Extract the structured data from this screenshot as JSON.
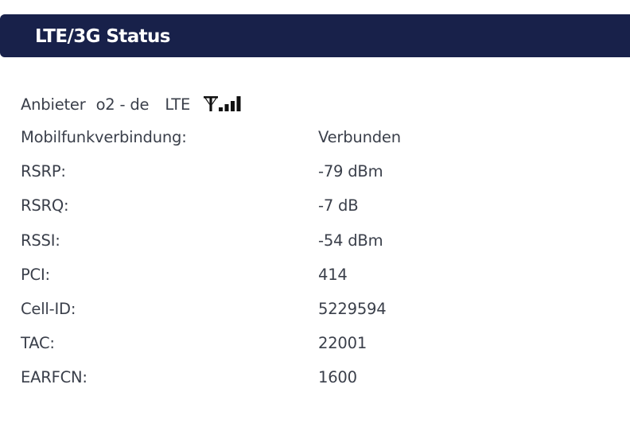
{
  "header": {
    "title": "LTE/3G Status"
  },
  "provider": {
    "label": "Anbieter",
    "name": "o2 - de",
    "technology": "LTE",
    "signal_icon": "signal-strength-icon",
    "signal_bars_lit": 4,
    "signal_bars_total": 4
  },
  "status_rows": [
    {
      "label": "Mobilfunkverbindung:",
      "value": "Verbunden"
    },
    {
      "label": "RSRP:",
      "value": "-79 dBm"
    },
    {
      "label": "RSRQ:",
      "value": "-7 dB"
    },
    {
      "label": "RSSI:",
      "value": "-54 dBm"
    },
    {
      "label": "PCI:",
      "value": "414"
    },
    {
      "label": "Cell-ID:",
      "value": "5229594"
    },
    {
      "label": "TAC:",
      "value": "22001"
    },
    {
      "label": "EARFCN:",
      "value": "1600"
    }
  ],
  "colors": {
    "header_bg": "#18214a",
    "header_text": "#ffffff",
    "body_text": "#3a3f4a",
    "icon": "#111111"
  }
}
